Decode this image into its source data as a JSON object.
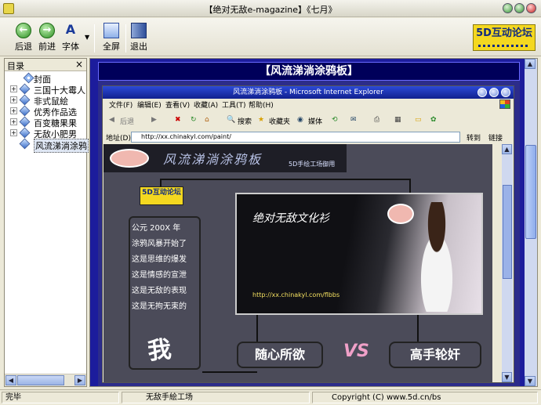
{
  "window": {
    "title": "【绝对无敌e-magazine】《七月》"
  },
  "toolbar": {
    "back_label": "后退",
    "forward_label": "前进",
    "font_label": "字体",
    "fullscreen_label": "全屏",
    "exit_label": "退出",
    "brand_label": "5D互动论坛"
  },
  "sidebar": {
    "title": "目录",
    "close_glyph": "×",
    "items": [
      {
        "label": "封面",
        "expandable": false
      },
      {
        "label": "三国十大霉人",
        "expandable": true
      },
      {
        "label": "非式鼠絵",
        "expandable": true
      },
      {
        "label": "优秀作品选",
        "expandable": true
      },
      {
        "label": "百变糖果果",
        "expandable": true
      },
      {
        "label": "无敌小肥男",
        "expandable": true
      },
      {
        "label": "风流涕淌涂鸦",
        "expandable": false,
        "selected": true
      }
    ]
  },
  "content": {
    "heading": "【风流涕淌涂鸦板】",
    "browser": {
      "title": "风流涕淌涂鸦板 - Microsoft Internet Explorer",
      "menu": [
        "文件(F)",
        "编辑(E)",
        "查看(V)",
        "收藏(A)",
        "工具(T)",
        "帮助(H)"
      ],
      "tools": {
        "back": "后退",
        "search": "搜索",
        "favorites": "收藏夹",
        "media": "媒体"
      },
      "address_label": "地址(D)",
      "address": "http://xx.chinakyl.com/paint/",
      "go_label": "转到",
      "links_label": "链接",
      "banner_title": "风流涕淌涂鸦板",
      "banner_subtitle": "5D手绘工场御用",
      "forum_logo": "5D互动论坛",
      "poem": [
        "公元 200X 年",
        "涂鸦风暴开始了",
        "这是思维的爆发",
        "这是情感的宣泄",
        "这是无敌的表现",
        "这是无拘无束的"
      ],
      "big_char": "我",
      "photo_title": "绝对无敌文化衫",
      "photo_url": "http://xx.chinakyl.com/flbbs",
      "left_pill": "随心所欲",
      "vs": "VS",
      "right_pill": "高手轮奸"
    }
  },
  "status": {
    "left": "完毕",
    "middle": "无敌手絵工场",
    "right": "Copyright (C) www.5d.cn/bs"
  }
}
